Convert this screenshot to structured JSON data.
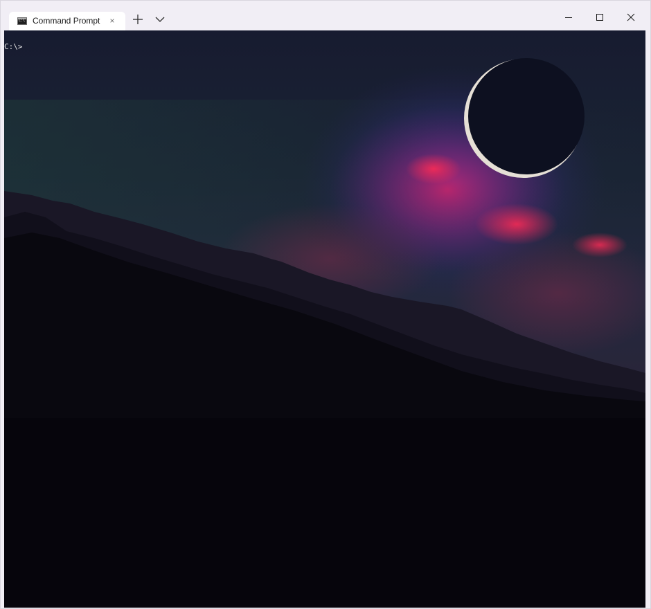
{
  "window": {
    "tabs": [
      {
        "title": "Command Prompt",
        "icon": "cmd-icon",
        "active": true
      }
    ],
    "close_tab_glyph": "×",
    "buttons": {
      "new_tab": "plus-icon",
      "dropdown": "chevron-down-icon",
      "minimize": "minimize-icon",
      "maximize": "maximize-icon",
      "close": "close-icon"
    }
  },
  "terminal": {
    "prompt": "C:\\>",
    "background_image": "night-sky-crescent-moon-over-mountains",
    "colors": {
      "sky_top": "#141a2c",
      "nebula_pink": "#d81e5b",
      "nebula_blue": "#3c3ca8",
      "mountain": "#0b0a14",
      "foreground": "#e6e6e6"
    }
  }
}
